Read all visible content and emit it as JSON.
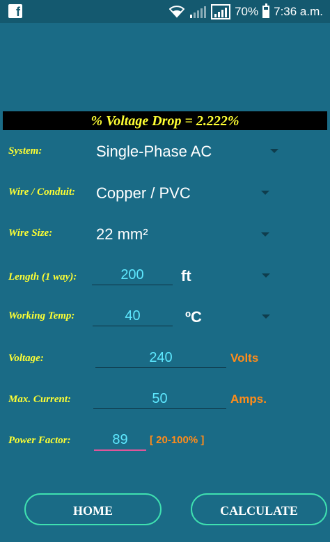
{
  "status": {
    "battery": "70%",
    "time": "7:36 a.m."
  },
  "result": {
    "text": "% Voltage Drop = 2.222%"
  },
  "form": {
    "system": {
      "label": "System:",
      "value": "Single-Phase AC"
    },
    "wire_conduit": {
      "label": "Wire / Conduit:",
      "value": "Copper / PVC"
    },
    "wire_size": {
      "label": "Wire Size:",
      "value": "22 mm²"
    },
    "length": {
      "label": "Length (1 way):",
      "value": "200",
      "unit": "ft"
    },
    "working_temp": {
      "label": "Working Temp:",
      "value": "40",
      "unit": "ºC"
    },
    "voltage": {
      "label": "Voltage:",
      "value": "240",
      "unit": "Volts"
    },
    "max_current": {
      "label": "Max. Current:",
      "value": "50",
      "unit": "Amps."
    },
    "power_factor": {
      "label": "Power Factor:",
      "value": "89",
      "hint": "[ 20-100% ]"
    }
  },
  "buttons": {
    "home": "HOME",
    "calculate": "CALCULATE"
  },
  "colors": {
    "background": "#1a6b86",
    "label": "#ffff33",
    "input_text": "#5ee8ff",
    "unit_orange": "#ff8c1a",
    "button_border": "#3fe0b0"
  }
}
